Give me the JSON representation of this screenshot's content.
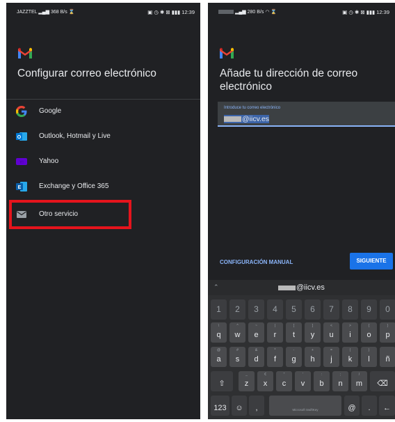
{
  "left_screen": {
    "status": {
      "carrier": "JAZZTEL",
      "speed": "368 B/s",
      "time": "12:39"
    },
    "title": "Configurar correo electrónico",
    "providers": [
      {
        "label": "Google",
        "icon": "google-icon",
        "color": "#4285f4"
      },
      {
        "label": "Outlook, Hotmail y Live",
        "icon": "outlook-icon",
        "color": "#0078d4"
      },
      {
        "label": "Yahoo",
        "icon": "yahoo-icon",
        "color": "#6001d2"
      },
      {
        "label": "Exchange y Office 365",
        "icon": "exchange-icon",
        "color": "#0a8ad6"
      },
      {
        "label": "Otro servicio",
        "icon": "mail-icon",
        "color": "#9aa0a6"
      }
    ],
    "highlight_color": "#e5141c"
  },
  "right_screen": {
    "status": {
      "speed": "280 B/s",
      "time": "12:39"
    },
    "title": "Añade tu dirección de correo electrónico",
    "email_field": {
      "hint": "Introduce tu correo electrónico",
      "value_suffix": "@iicv.es"
    },
    "manual_button": "CONFIGURACIÓN MANUAL",
    "next_button": "SIGUIENTE",
    "keyboard": {
      "suggestion": "@iicv.es",
      "branding": "Microsoft SwiftKey",
      "numbers": [
        "1",
        "2",
        "3",
        "4",
        "5",
        "6",
        "7",
        "8",
        "9",
        "0"
      ],
      "row1": [
        {
          "k": "q",
          "s": "\\"
        },
        {
          "k": "w",
          "s": "^"
        },
        {
          "k": "e",
          "s": "~"
        },
        {
          "k": "r",
          "s": "|"
        },
        {
          "k": "t",
          "s": "["
        },
        {
          "k": "y",
          "s": "]"
        },
        {
          "k": "u",
          "s": "<"
        },
        {
          "k": "i",
          "s": ">"
        },
        {
          "k": "o",
          "s": "{"
        },
        {
          "k": "p",
          "s": "}"
        }
      ],
      "row2": [
        {
          "k": "a",
          "s": "@"
        },
        {
          "k": "s",
          "s": "#"
        },
        {
          "k": "d",
          "s": "&"
        },
        {
          "k": "f",
          "s": "*"
        },
        {
          "k": "g",
          "s": "-"
        },
        {
          "k": "h",
          "s": "+"
        },
        {
          "k": "j",
          "s": "="
        },
        {
          "k": "k",
          "s": "("
        },
        {
          "k": "l",
          "s": ")"
        },
        {
          "k": "ñ",
          "s": ""
        }
      ],
      "row3": [
        {
          "k": "z",
          "s": "_"
        },
        {
          "k": "x",
          "s": "€"
        },
        {
          "k": "c",
          "s": "\""
        },
        {
          "k": "v",
          "s": "'"
        },
        {
          "k": "b",
          "s": ":"
        },
        {
          "k": "n",
          "s": ";"
        },
        {
          "k": "m",
          "s": "/"
        }
      ],
      "symbols_key": "123",
      "at_key": "@"
    },
    "accent_color": "#8ab4f8",
    "button_color": "#1a73e8"
  }
}
